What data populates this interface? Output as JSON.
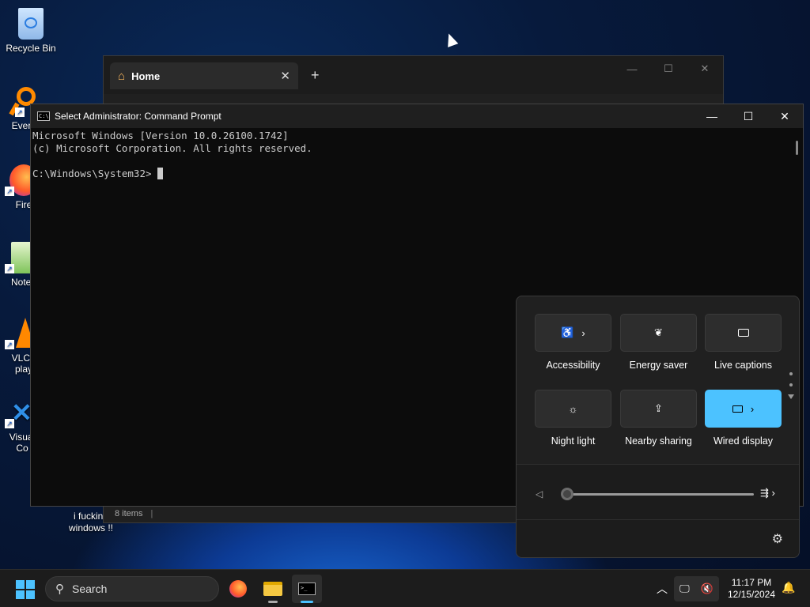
{
  "desktop": {
    "icons": [
      {
        "label": "Recycle Bin"
      },
      {
        "label": "Every"
      },
      {
        "label": "Fire"
      },
      {
        "label": "Notep"
      },
      {
        "label": "VLC r\nplay"
      },
      {
        "label": "Visual\nCo"
      }
    ],
    "wallpaper_text": "i fucking\nwindows !!"
  },
  "explorer": {
    "tab_label": "Home",
    "status_items": "8 items"
  },
  "cmd": {
    "title": "Select Administrator: Command Prompt",
    "line1": "Microsoft Windows [Version 10.0.26100.1742]",
    "line2": "(c) Microsoft Corporation. All rights reserved.",
    "prompt": "C:\\Windows\\System32>"
  },
  "quick_settings": {
    "tiles": [
      {
        "label": "Accessibility",
        "icon": "accessibility-icon",
        "on": false
      },
      {
        "label": "Energy saver",
        "icon": "leaf-icon",
        "on": false
      },
      {
        "label": "Live captions",
        "icon": "captions-icon",
        "on": false
      },
      {
        "label": "Night light",
        "icon": "brightness-icon",
        "on": false
      },
      {
        "label": "Nearby sharing",
        "icon": "share-icon",
        "on": false
      },
      {
        "label": "Wired display",
        "icon": "cast-icon",
        "on": true
      }
    ],
    "volume_level": 0
  },
  "taskbar": {
    "search_placeholder": "Search",
    "time": "11:17 PM",
    "date": "12/15/2024"
  },
  "colors": {
    "accent": "#4cc2ff",
    "taskbar_bg": "#1c1c1c",
    "console_bg": "#0c0c0c"
  }
}
